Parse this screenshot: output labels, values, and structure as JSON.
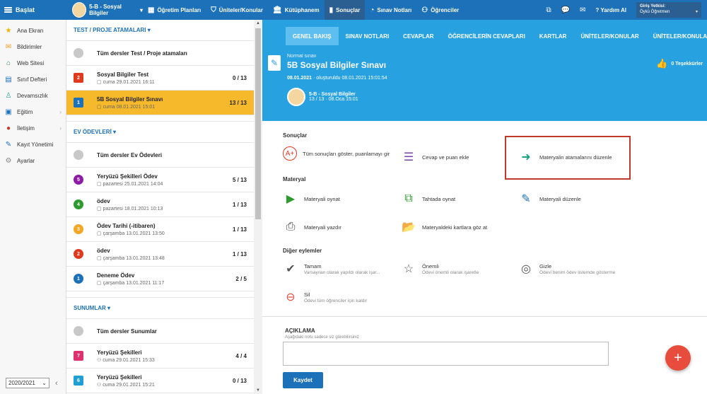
{
  "topbar": {
    "start_label": "Başlat",
    "class_label": "5-B - Sosyal Bilgiler",
    "nav": [
      {
        "label": "Öğretim Planları",
        "icon": "calendar-icon"
      },
      {
        "label": "Üniteler/Konular",
        "icon": "shield-icon"
      },
      {
        "label": "Kütüphanem",
        "icon": "library-icon"
      },
      {
        "label": "Sonuçlar",
        "icon": "chart-icon"
      },
      {
        "label": "Sınav Notları",
        "icon": "dashboard-icon"
      },
      {
        "label": "Öğrenciler",
        "icon": "students-icon"
      }
    ],
    "help_label": "Yardım Al",
    "user_title": "Giriş Yetkisi:",
    "user_role": "Öykü Öğretmen"
  },
  "sidebar": {
    "items": [
      {
        "label": "Ana Ekran",
        "icon": "star-icon",
        "color": "#f0b400"
      },
      {
        "label": "Bildirimler",
        "icon": "mail-icon",
        "color": "#f0a020"
      },
      {
        "label": "Web Sitesi",
        "icon": "home-icon",
        "color": "#2e8b57"
      },
      {
        "label": "Sınıf Defteri",
        "icon": "notebook-icon",
        "color": "#1c71b8"
      },
      {
        "label": "Devamsızlık",
        "icon": "user-icon",
        "color": "#2aa198"
      },
      {
        "label": "Eğitim",
        "icon": "education-icon",
        "color": "#1c71b8"
      },
      {
        "label": "İletişim",
        "icon": "chat-icon",
        "color": "#c0392b"
      },
      {
        "label": "Kayıt Yönetimi",
        "icon": "pen-icon",
        "color": "#1c71b8"
      },
      {
        "label": "Ayarlar",
        "icon": "gear-icon",
        "color": "#888888"
      }
    ],
    "year": "2020/2021"
  },
  "list": {
    "sec1": "TEST / PROJE ATAMALARI",
    "sec1_all": "Tüm dersler Test / Proje atamaları",
    "sec1_rows": [
      {
        "num": "2",
        "color": "#e03a1e",
        "title": "Sosyal Bilgiler Test",
        "sub": "cuma 29.01.2021 16:11",
        "count": "0 / 13"
      },
      {
        "num": "1",
        "color": "#1c71b8",
        "title": "5B Sosyal Bilgiler Sınavı",
        "sub": "cuma 08.01.2021 15:01",
        "count": "13 / 13"
      }
    ],
    "sec2": "EV ÖDEVLERİ",
    "sec2_all": "Tüm dersler Ev Ödevleri",
    "sec2_rows": [
      {
        "num": "5",
        "color": "#8e1aa8",
        "title": "Yeryüzü Şekilleri Ödev",
        "sub": "pazartesi 25.01.2021 14:04",
        "count": "5 / 13"
      },
      {
        "num": "4",
        "color": "#2e9b2e",
        "title": "ödev",
        "sub": "pazartesi 18.01.2021 10:13",
        "count": "1 / 13"
      },
      {
        "num": "3",
        "color": "#f5a623",
        "title": "Ödev Tarihi (-itibaren)",
        "sub": "çarşamba 13.01.2021 13:50",
        "count": "1 / 13"
      },
      {
        "num": "2",
        "color": "#e03a1e",
        "title": "ödev",
        "sub": "çarşamba 13.01.2021 13:48",
        "count": "1 / 13"
      },
      {
        "num": "1",
        "color": "#1c71b8",
        "title": "Deneme Ödev",
        "sub": "çarşamba 13.01.2021 11:17",
        "count": "2 / 5"
      }
    ],
    "sec3": "SUNUMLAR",
    "sec3_all": "Tüm dersler Sunumlar",
    "sec3_rows": [
      {
        "num": "7",
        "color": "#e0306e",
        "title": "Yeryüzü Şekilleri",
        "sub": "cuma 29.01.2021 15:33",
        "count": "4 / 4"
      },
      {
        "num": "6",
        "color": "#1f9fd4",
        "title": "Yeryüzü Şekilleri",
        "sub": "cuma 29.01.2021 15:21",
        "count": "0 / 13"
      }
    ]
  },
  "tabs": [
    "GENEL BAKIŞ",
    "SINAV NOTLARI",
    "CEVAPLAR",
    "ÖĞRENCİLERİN CEVAPLARI",
    "KARTLAR",
    "ÜNİTELER/KONULAR",
    "ÜNİTELER/KONULAR AĞ"
  ],
  "header": {
    "type": "Normal sınav",
    "title": "5B Sosyal Bilgiler Sınavı",
    "date_bold": "08.01.2021",
    "date_rest": " · oluşturuldu 08.01.2021 15:01:54",
    "class_name": "5-B - Sosyal Bilgiler",
    "class_info": "13 / 13 · 08.Oca 15:01",
    "thanks": "0 Teşekkürler"
  },
  "results": {
    "heading": "Sonuçlar",
    "show_all": "Tüm sonuçları göster, puanlamayı gir",
    "add_answer": "Cevap ve puan ekle",
    "edit_assign": "Materyalin atamalarını düzenle"
  },
  "material": {
    "heading": "Materyal",
    "play": "Materyali oynat",
    "board": "Tahtada oynat",
    "edit": "Materyali düzenle",
    "print": "Materyali yazdır",
    "cards": "Materyaldeki kartlara göz at"
  },
  "other": {
    "heading": "Diğer eylemler",
    "done": "Tamam",
    "done_sub": "Varsayılan olarak yapıldı olarak işar...",
    "important": "Önemli",
    "important_sub": "Ödevi önemli olarak işaretle",
    "hide": "Gizle",
    "hide_sub": "Ödevi benim ödev listemde gösterme",
    "delete": "Sil",
    "delete_sub": "Ödevi tüm öğrenciler için kaldır"
  },
  "description": {
    "heading": "AÇIKLAMA",
    "note": "Aşağıdaki notu sadece siz görebilirsiniz",
    "save": "Kaydet"
  }
}
